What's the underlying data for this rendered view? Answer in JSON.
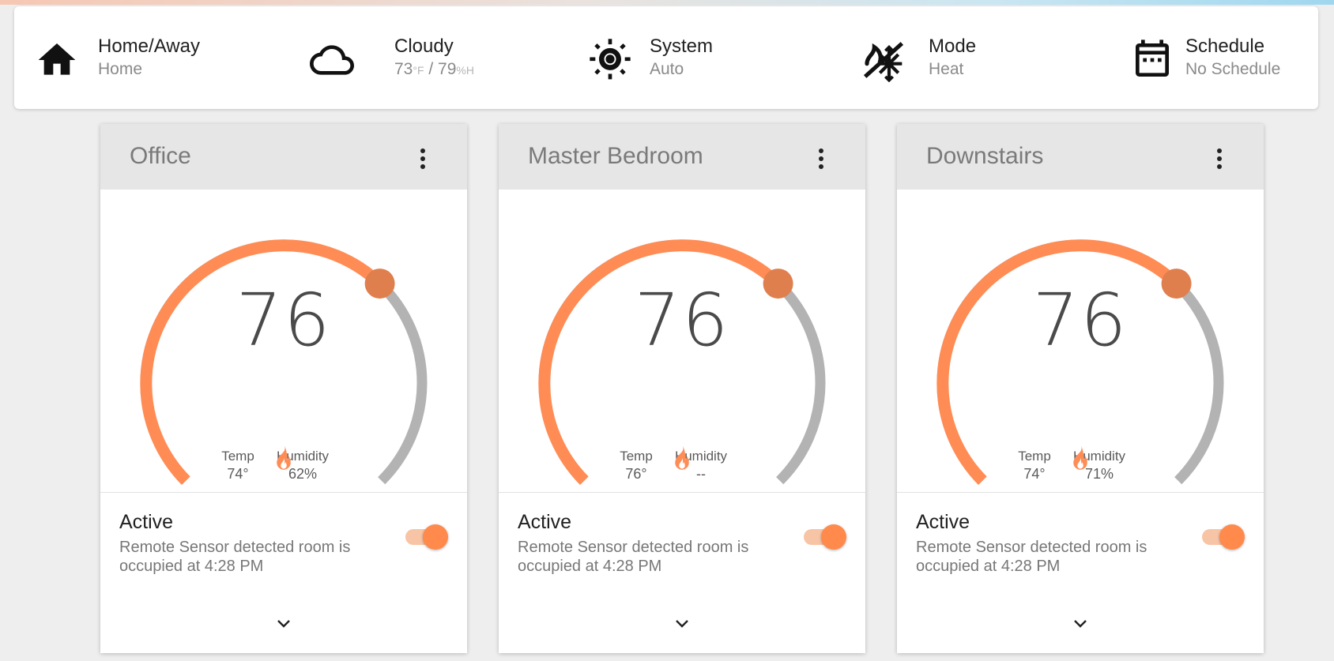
{
  "status_bar": {
    "home_away": {
      "title": "Home/Away",
      "value": "Home",
      "icon": "home-icon"
    },
    "weather": {
      "title": "Cloudy",
      "temp": "73",
      "temp_unit": "°F",
      "separator": " / ",
      "humidity": "79",
      "humidity_unit": "%H",
      "icon": "cloud-icon"
    },
    "system": {
      "title": "System",
      "value": "Auto",
      "icon": "sun-icon"
    },
    "mode": {
      "title": "Mode",
      "value": "Heat",
      "icon": "sun-snowflake-icon"
    },
    "schedule": {
      "title": "Schedule",
      "value": "No Schedule",
      "icon": "calendar-icon"
    }
  },
  "colors": {
    "accent": "#ff8c55",
    "knob": "#e07f4e",
    "track": "#b3b3b3"
  },
  "thermostats": [
    {
      "name": "Office",
      "setpoint": "76",
      "temp_label": "Temp",
      "temp": "74°",
      "humidity_label": "Humidity",
      "humidity": "62%",
      "status_title": "Active",
      "status_desc": "Remote Sensor detected room is occupied at 4:28 PM",
      "active": true
    },
    {
      "name": "Master Bedroom",
      "setpoint": "76",
      "temp_label": "Temp",
      "temp": "76°",
      "humidity_label": "Humidity",
      "humidity": "--",
      "status_title": "Active",
      "status_desc": "Remote Sensor detected room is occupied at 4:28 PM",
      "active": true
    },
    {
      "name": "Downstairs",
      "setpoint": "76",
      "temp_label": "Temp",
      "temp": "74°",
      "humidity_label": "Humidity",
      "humidity": "71%",
      "status_title": "Active",
      "status_desc": "Remote Sensor detected room is occupied at 4:28 PM",
      "active": true
    }
  ]
}
